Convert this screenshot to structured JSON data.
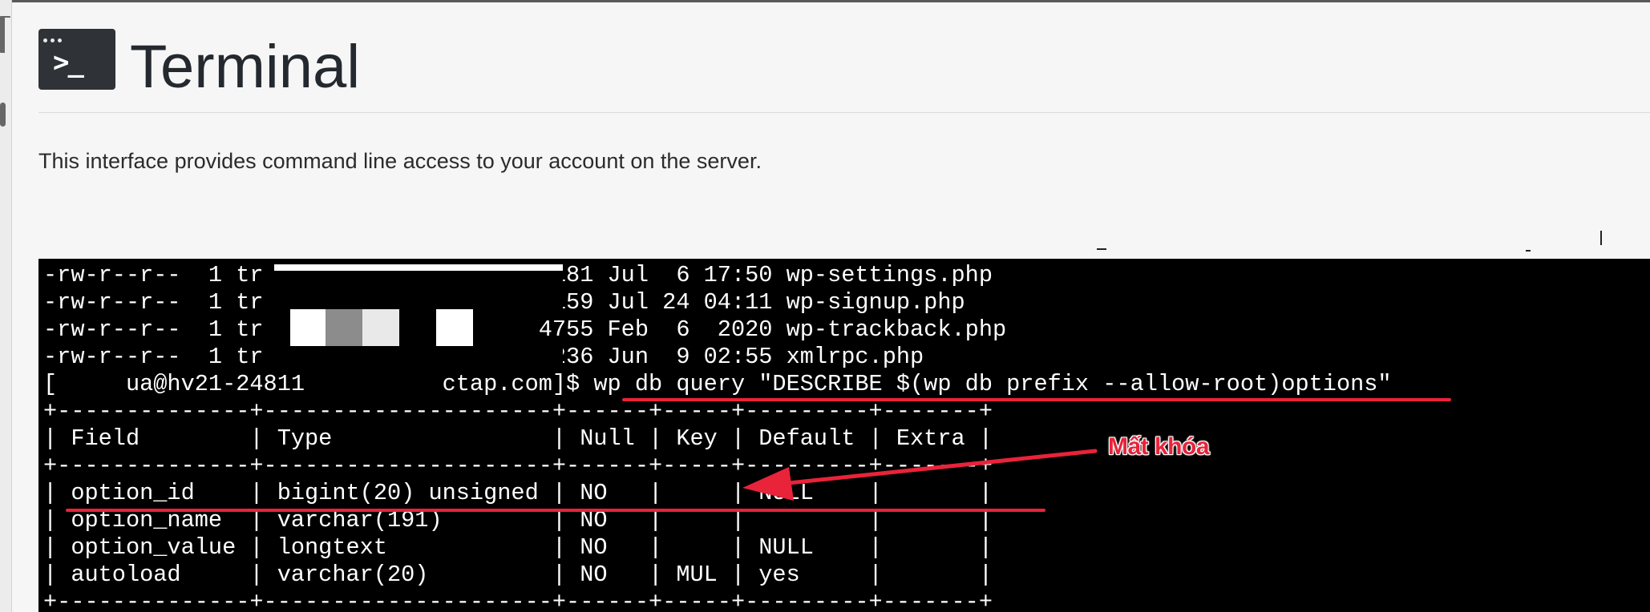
{
  "page": {
    "title": "Terminal",
    "logo_prompt": ">_",
    "description": "This interface provides command line access to your account on the server."
  },
  "terminal": {
    "lines": [
      "-rw-r--r--  1 tr                   20181 Jul  6 17:50 wp-settings.php",
      "-rw-r--r--  1 tr                   31159 Jul 24 04:11 wp-signup.php",
      "-rw-r--r--  1 tr                    4755 Feb  6  2020 wp-trackback.php",
      "-rw-r--r--  1 tr                    3236 Jun  9 02:55 xmlrpc.php",
      "[     ua@hv21-24811          ctap.com]$ wp db query \"DESCRIBE $(wp db prefix --allow-root)options\"",
      "+--------------+---------------------+------+-----+---------+-------+",
      "| Field        | Type                | Null | Key | Default | Extra |",
      "+--------------+---------------------+------+-----+---------+-------+",
      "| option_id    | bigint(20) unsigned | NO   |     | NULL    |       |",
      "| option_name  | varchar(191)        | NO   |     |         |       |",
      "| option_value | longtext            | NO   |     | NULL    |       |",
      "| autoload     | varchar(20)         | NO   | MUL | yes     |       |",
      "+--------------+---------------------+------+-----+---------+-------+"
    ]
  },
  "annotation": {
    "label": "Mất khóa",
    "color": "#e8233a"
  },
  "icons": {
    "logo": "terminal-icon"
  }
}
